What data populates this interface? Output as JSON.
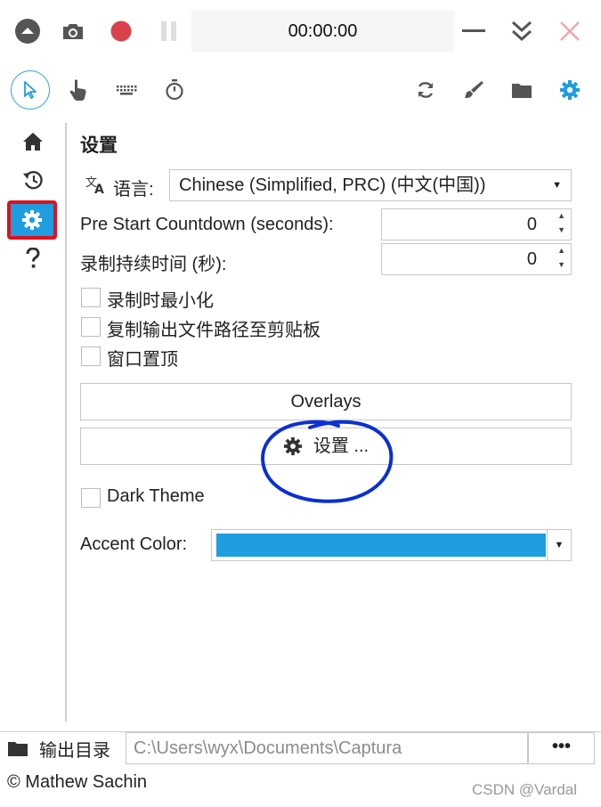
{
  "topbar": {
    "timer": "00:00:00"
  },
  "settings": {
    "title": "设置",
    "language_label": "语言:",
    "language_value": "Chinese (Simplified, PRC) (中文(中国))",
    "countdown_label": "Pre Start Countdown (seconds):",
    "countdown_value": "0",
    "duration_label": "录制持续时间 (秒):",
    "duration_value": "0",
    "checkboxes": [
      "录制时最小化",
      "复制输出文件路径至剪贴板",
      "窗口置顶"
    ],
    "overlays_button": "Overlays",
    "settings_button": "设置 ...",
    "dark_theme_label": "Dark Theme",
    "accent_label": "Accent Color:",
    "accent_color": "#1e9de0"
  },
  "bottom": {
    "output_dir_label": "输出目录",
    "output_path": "C:\\Users\\wyx\\Documents\\Captura",
    "more_label": "•••",
    "copyright": "© Mathew Sachin",
    "watermark": "CSDN @Vardal"
  },
  "colors": {
    "accent": "#1e9de0",
    "highlight_red": "#e0101f",
    "annotation_blue": "#0a2fd6"
  },
  "icons": {
    "collapse": "chevron-up-circle-icon",
    "screenshot": "camera-icon",
    "record": "record-icon",
    "pause": "pause-icon",
    "minimize": "minimize-icon",
    "tray": "double-chevron-down-icon",
    "close": "close-icon",
    "cursor": "cursor-icon",
    "clicks": "hand-pointer-icon",
    "keystrokes": "keyboard-icon",
    "timer": "stopwatch-icon",
    "refresh": "refresh-icon",
    "brush": "brush-icon",
    "folder": "folder-icon",
    "settings": "gear-icon",
    "home": "home-icon",
    "history": "history-icon",
    "help": "question-icon",
    "translate": "translate-icon"
  }
}
